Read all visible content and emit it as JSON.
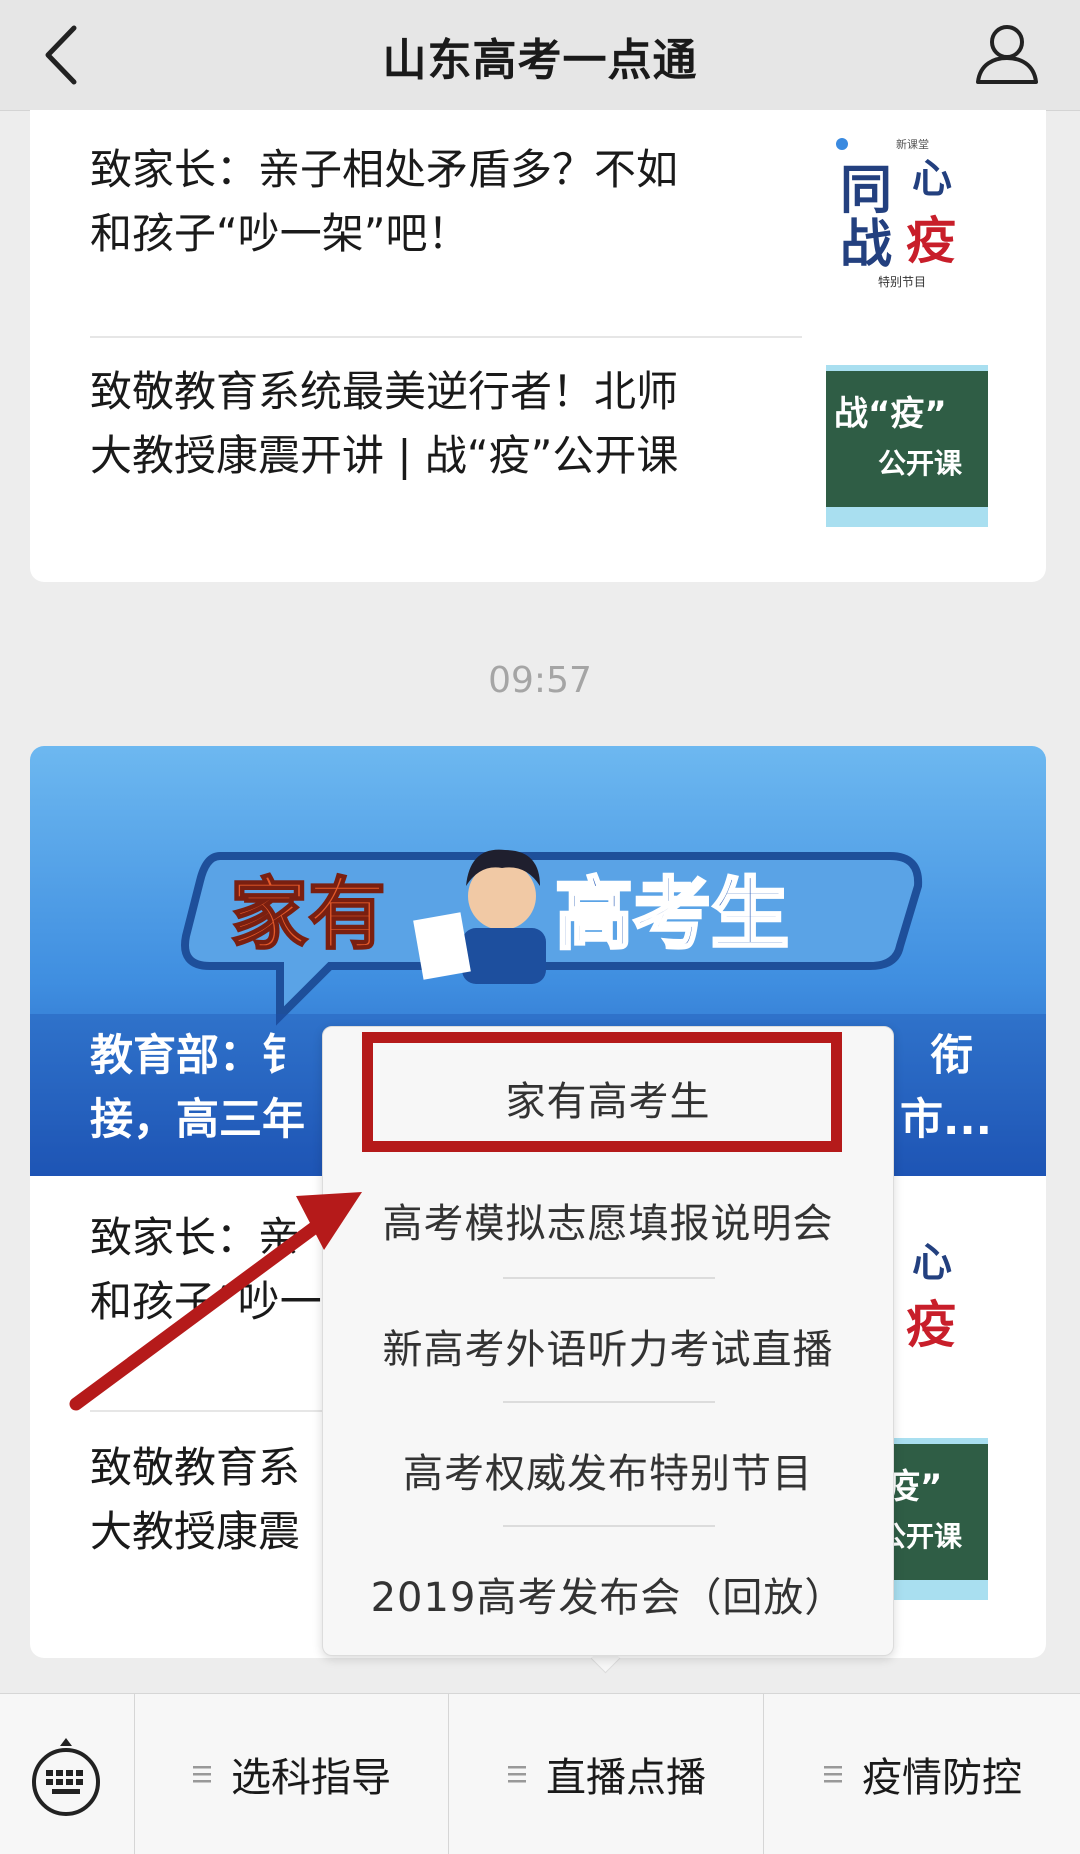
{
  "header": {
    "title": "山东高考一点通"
  },
  "articles_top": [
    {
      "line1": "致家长：亲子相处矛盾多？不如",
      "line2": "和孩子“吵一架”吧！"
    },
    {
      "line1": "致敬教育系统最美逆行者！北师",
      "line2": "大教授康震开讲 | 战“疫”公开课"
    }
  ],
  "thumbs": {
    "t1": {
      "small": "新课堂",
      "a": "同",
      "b": "心",
      "c": "战",
      "d": "疫",
      "bottom": "特别节目"
    },
    "t2": {
      "a": "战“疫”",
      "b": "公开课"
    }
  },
  "timestamp": "09:57",
  "banner": {
    "word1": "家有",
    "word2": "高考生",
    "caption_line1": "教育部：钅",
    "caption_line1_tail": "衔",
    "caption_line2": "接，高三年",
    "caption_line2_tail": "市..."
  },
  "articles_bottom": [
    {
      "line1": "致家长：亲",
      "line2": "和孩子“吵一"
    },
    {
      "line1": "致敬教育系",
      "line2": "大教授康震"
    }
  ],
  "popup_menu": {
    "items": [
      "家有高考生",
      "高考模拟志愿填报说明会",
      "新高考外语听力考试直播",
      "高考权威发布特别节目",
      "2019高考发布会（回放）"
    ]
  },
  "bottom_tabs": [
    "选科指导",
    "直播点播",
    "疫情防控"
  ],
  "colors": {
    "highlight": "#b51a1a",
    "banner_blue": "#2f78d6"
  }
}
